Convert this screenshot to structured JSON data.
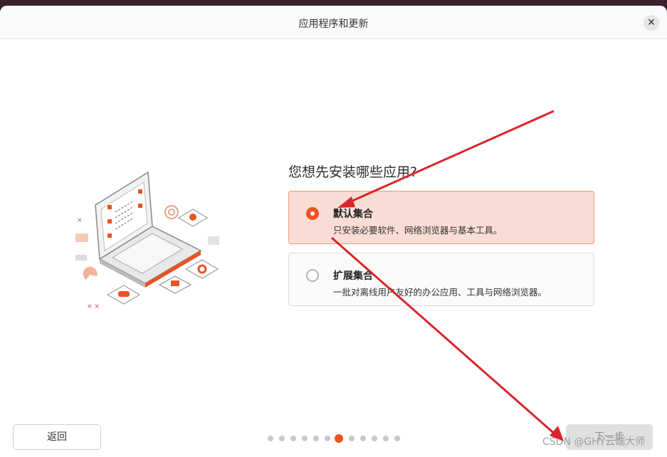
{
  "window": {
    "title": "应用程序和更新"
  },
  "main": {
    "question": "您想先安装哪些应用?",
    "options": [
      {
        "title": "默认集合",
        "description": "只安装必要软件、网络浏览器与基本工具。",
        "selected": true
      },
      {
        "title": "扩展集合",
        "description": "一批对离线用户友好的办公应用、工具与网络浏览器。",
        "selected": false
      }
    ]
  },
  "footer": {
    "back_label": "返回",
    "next_label": "下一步",
    "progress": {
      "total_steps": 12,
      "current_step": 7
    }
  },
  "watermark": "CSDN @GHY云端大师",
  "colors": {
    "accent": "#e95420",
    "selected_bg": "#f9ddd4",
    "annotation_arrow": "#d9262c"
  },
  "icons": [
    "close-icon",
    "laptop-illustration",
    "annotation-arrow"
  ]
}
